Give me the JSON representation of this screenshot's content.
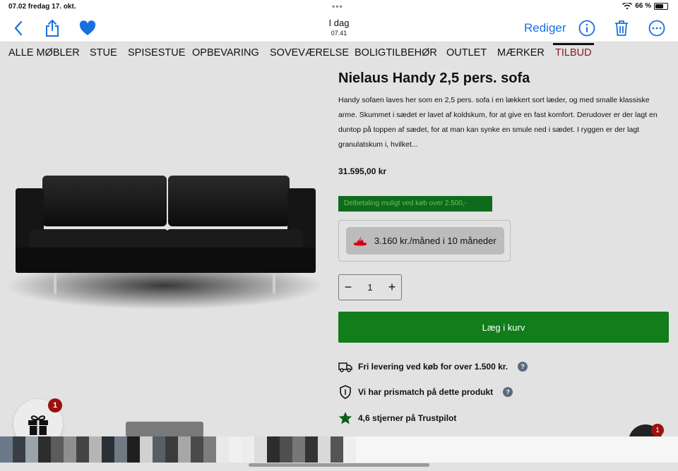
{
  "status_bar": {
    "time": "07.02 fredag 17. okt.",
    "battery": "66 %",
    "battery_level": 0.66
  },
  "toolbar": {
    "date_label": "I dag",
    "time_label": "07.41",
    "edit_label": "Rediger"
  },
  "nav": {
    "items": [
      "ALLE MØBLER",
      "STUE",
      "SPISESTUE",
      "OPBEVARING",
      "SOVEVÆRELSE",
      "BOLIGTILBEHØR",
      "OUTLET",
      "MÆRKER",
      "TILBUD"
    ],
    "active": "TILBUD"
  },
  "product": {
    "title": "Nielaus Handy 2,5 pers. sofa",
    "description": "Handy sofaen laves her som en 2,5 pers. sofa i en lækkert sort læder, og med smalle klassiske arme. Skummet i sædet er lavet af koldskum, for at give en fast komfort. Derudover er der lagt en duntop på toppen af sædet, for at man kan synke en smule ned i sædet. I ryggen er der lagt granulatskum i, hvilket...",
    "price": "31.595,00 kr",
    "finance_note": "Delbetaling muligt ved køb over 2.500,-",
    "installment": "3.160 kr./måned i 10 måneder",
    "quantity": "1",
    "add_to_cart": "Læg i kurv"
  },
  "features": [
    {
      "icon": "truck-icon",
      "text": "Fri levering ved køb for over 1.500 kr."
    },
    {
      "icon": "shield-icon",
      "text": "Vi har prismatch på dette produkt"
    },
    {
      "icon": "star-icon",
      "text": "4,6 stjerner på Trustpilot"
    }
  ],
  "badges": {
    "gift_count": "1",
    "chat_count": "1"
  },
  "colors": {
    "accent": "#1a6fe0",
    "cart_green": "#117d1b",
    "finance_green": "#0f6b1c",
    "active_nav": "#8b1a1a"
  }
}
